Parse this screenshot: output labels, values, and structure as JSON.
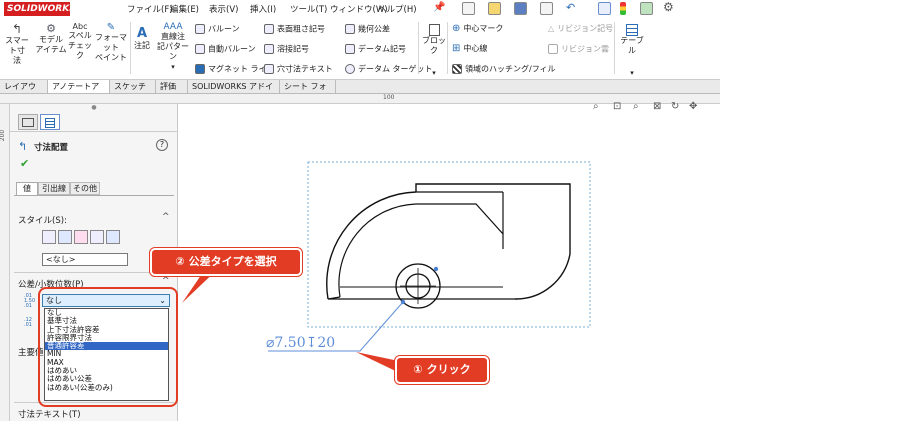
{
  "app": {
    "logo_text": "SOLIDWORKS",
    "menus": [
      "ファイル(F)",
      "編集(E)",
      "表示(V)",
      "挿入(I)",
      "ツール(T)",
      "ウィンドウ(W)",
      "ヘルプ(H)"
    ]
  },
  "ribbon": {
    "smart_dimension": "スマート寸\n法",
    "model_items": "モデル\nアイテム",
    "spell_check": "スペル\nチェック",
    "format_painter": "フォーマット\nペイント",
    "note": "注記",
    "linear_note_pattern": "直線注\n記パターン",
    "balloon": "バルーン",
    "auto_balloon": "自動バルーン",
    "magnetic_line": "マグネット ライン",
    "surface_finish": "表面粗さ記号",
    "weld_symbol": "溶接記号",
    "hole_callout": "穴寸法テキスト",
    "geometric_tolerance": "幾何公差",
    "datum_feature": "データム記号",
    "datum_target": "データム ターゲット",
    "block": "ブロック",
    "center_mark": "中心マーク",
    "centerline": "中心線",
    "area_hatch": "領域のハッチング/フィル",
    "revision_symbol": "リビジョン記号",
    "revision_cloud": "リビジョン雲",
    "table": "テーブル"
  },
  "tabs": [
    "レイアウト表示",
    "アノテートアイテム",
    "スケッチ",
    "評価",
    "SOLIDWORKS アドイン",
    "シート フォーマット"
  ],
  "ruler": {
    "top_mark": "100",
    "left_mark": "200"
  },
  "property_manager": {
    "title": "寸法配置",
    "help": "?",
    "subtabs": [
      "値",
      "引出線",
      "その他"
    ],
    "style_label": "スタイル(S):",
    "style_value": "<なし>",
    "tolerance_label": "公差/小数位数(P)",
    "tolerance_value": "なし",
    "primary_value_label": "主要値",
    "dimension_text_label": "寸法テキスト(T)",
    "tolerance_options": [
      "なし",
      "基準寸法",
      "上下寸法許容差",
      "許容限界寸法",
      "普通許容差",
      "MIN",
      "MAX",
      "はめあい",
      "はめあい公差",
      "はめあい(公差のみ)"
    ],
    "highlighted_option": "普通許容差"
  },
  "drawing": {
    "dimension_text": "⌀7.50↧20"
  },
  "callouts": {
    "step1": "① クリック",
    "step2": "② 公差タイプを選択"
  },
  "colors": {
    "callout_red": "#e23c24",
    "highlight_blue": "#3166c4",
    "dimension_blue": "#5f8fd8",
    "logo_red": "#d51e20"
  }
}
